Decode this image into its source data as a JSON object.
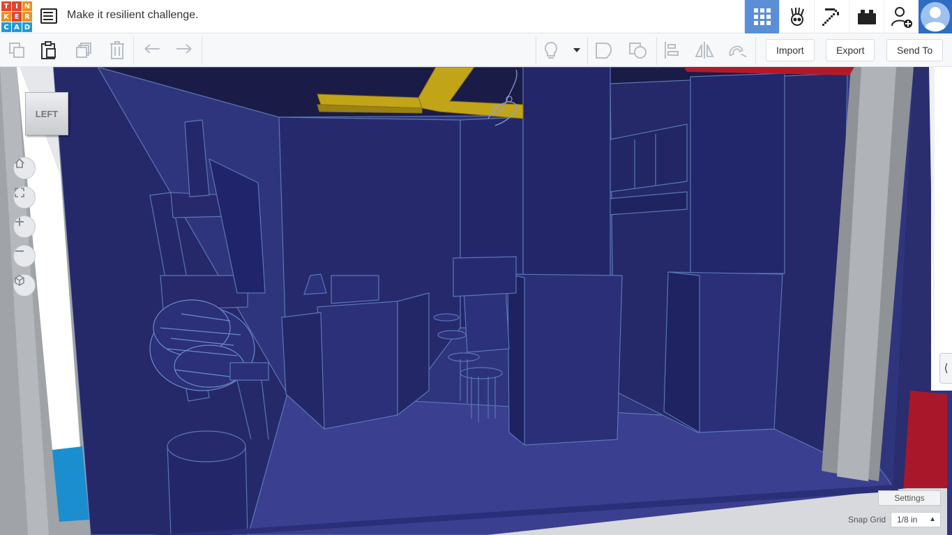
{
  "logo": {
    "letters": [
      "T",
      "I",
      "N",
      "K",
      "E",
      "R",
      "C",
      "A",
      "D"
    ],
    "colors": [
      "#e4442b",
      "#e4442b",
      "#f08f1c",
      "#f08f1c",
      "#e4442b",
      "#f08f1c",
      "#1f9bd6",
      "#1f9bd6",
      "#1f9bd6"
    ]
  },
  "header": {
    "title": "Make it resilient challenge."
  },
  "top_right": {
    "active_color": "#5a8fd6",
    "icons": [
      "grid-view-icon",
      "sim-lab-icon",
      "minecraft-pickaxe-icon",
      "brick-icon",
      "add-user-icon",
      "avatar-icon"
    ]
  },
  "toolbar": {
    "import_label": "Import",
    "export_label": "Export",
    "send_to_label": "Send To"
  },
  "viewport": {
    "view_cube_label": "LEFT",
    "settings_label": "Settings",
    "snap_grid_label": "Snap Grid",
    "snap_grid_value": "1/8 in"
  }
}
